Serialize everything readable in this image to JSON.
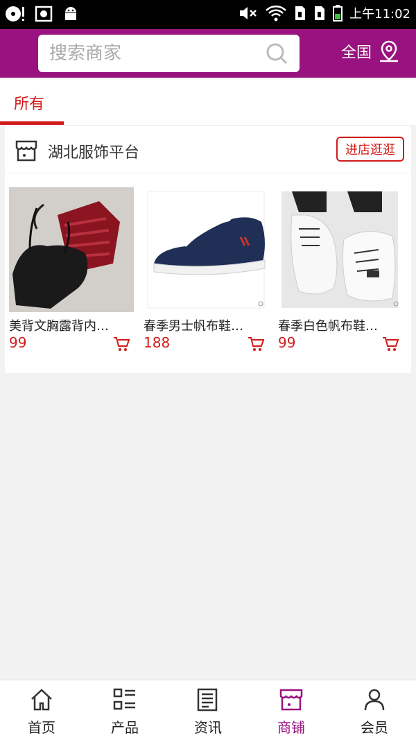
{
  "status_bar": {
    "time": "上午11:02"
  },
  "header": {
    "search_placeholder": "搜索商家",
    "region_label": "全国"
  },
  "tabs": [
    {
      "label": "所有",
      "active": true
    }
  ],
  "shop": {
    "name": "湖北服饰平台",
    "visit_label": "进店逛逛",
    "products": [
      {
        "name": "美背文胸露背内…",
        "price": "99"
      },
      {
        "name": "春季男士帆布鞋…",
        "price": "188"
      },
      {
        "name": "春季白色帆布鞋…",
        "price": "99"
      }
    ]
  },
  "bottom_nav": [
    {
      "label": "首页",
      "icon": "home-icon"
    },
    {
      "label": "产品",
      "icon": "list-icon"
    },
    {
      "label": "资讯",
      "icon": "news-icon"
    },
    {
      "label": "商铺",
      "icon": "shop-icon",
      "active": true
    },
    {
      "label": "会员",
      "icon": "user-icon"
    }
  ],
  "colors": {
    "brand": "#99127f",
    "accent_red": "#d11a1a"
  }
}
